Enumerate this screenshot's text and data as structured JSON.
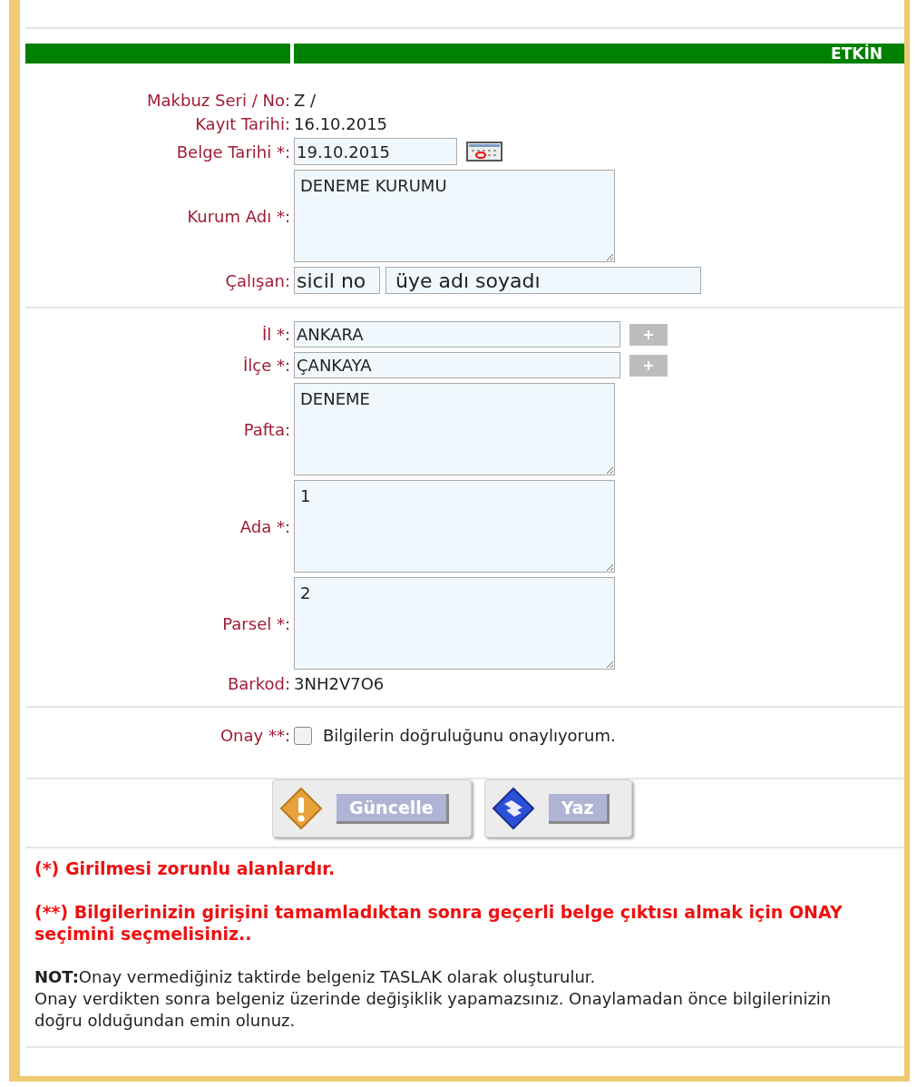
{
  "status_badge": "ETKİN",
  "sections": [
    {
      "fields": [
        {
          "kind": "static",
          "label": "Makbuz Seri / No:",
          "value": "Z /"
        },
        {
          "kind": "static",
          "label": "Kayıt Tarihi:",
          "value": "16.10.2015"
        },
        {
          "kind": "date",
          "label": "Belge Tarihi *:",
          "value": "19.10.2015"
        },
        {
          "kind": "textarea",
          "label": "Kurum Adı *:",
          "value": "DENEME KURUMU"
        },
        {
          "kind": "pair",
          "label": "Çalışan:",
          "values": [
            "sicil no",
            "üye adı soyadı"
          ]
        }
      ]
    },
    {
      "fields": [
        {
          "kind": "add",
          "label": "İl *:",
          "value": "ANKARA"
        },
        {
          "kind": "add",
          "label": "İlçe *:",
          "value": "ÇANKAYA"
        },
        {
          "kind": "textarea",
          "label": "Pafta:",
          "value": "DENEME"
        },
        {
          "kind": "textarea",
          "label": "Ada *:",
          "value": "1"
        },
        {
          "kind": "textarea",
          "label": "Parsel *:",
          "value": "2"
        },
        {
          "kind": "static",
          "label": "Barkod:",
          "value": "3NH2V7O6"
        }
      ]
    },
    {
      "fields": [
        {
          "kind": "checkbox",
          "label": "Onay **:",
          "text": "Bilgilerin doğruluğunu onaylıyorum.",
          "checked": false
        }
      ]
    }
  ],
  "buttons": [
    {
      "kind": "warning",
      "label": "Güncelle"
    },
    {
      "kind": "print",
      "label": "Yaz"
    }
  ],
  "warnings": [
    "(*) Girilmesi zorunlu alanlardır.",
    "(**) Bilgilerinizin girişini tamamladıktan sonra geçerli belge çıktısı almak için ONAY seçimini seçmelisiniz.."
  ],
  "notes": [
    "**NOT:**Onay vermediğiniz taktirde belgeniz TASLAK olarak oluşturulur.",
    "Onay verdikten sonra belgeniz üzerinde değişiklik yapamazsınız. Onaylamadan önce bilgilerinizin doğru olduğundan emin olunuz."
  ]
}
